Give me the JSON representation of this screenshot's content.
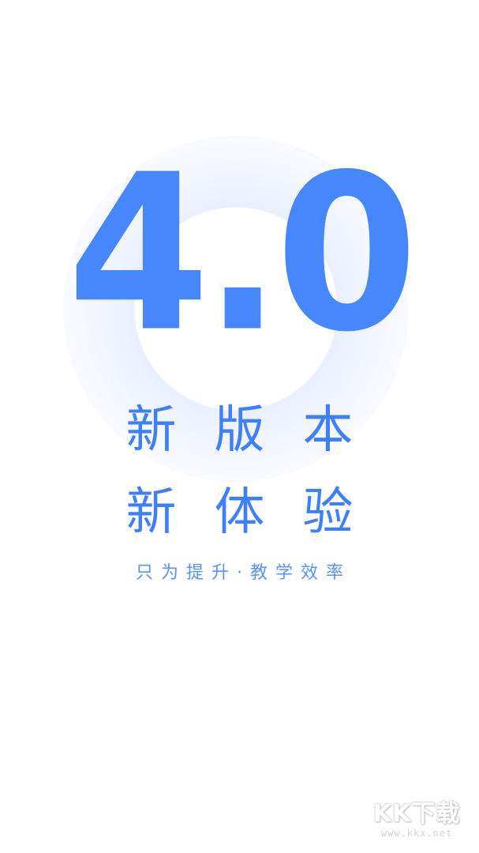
{
  "splash": {
    "version": "4.0",
    "headline_line1": "新版本",
    "headline_line2": "新体验",
    "slogan": "只为提升·教学效率"
  },
  "watermark": {
    "logo_text": "KK下载",
    "url": "www.kkx.net"
  },
  "colors": {
    "primary_blue": "#4687FD",
    "headline_blue": "#3F80F9",
    "ring_tint": "#E8EFFF",
    "background": "#FFFFFF"
  }
}
